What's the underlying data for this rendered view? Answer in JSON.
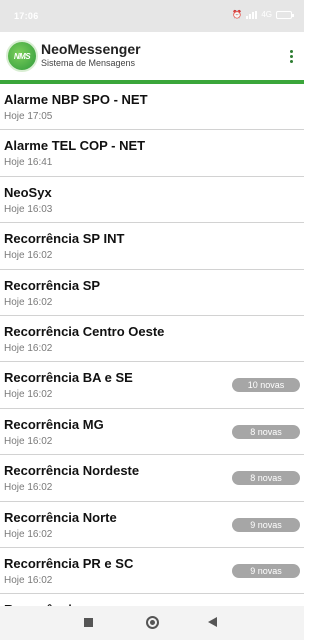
{
  "status_bar": {
    "time": "17:06",
    "network": "4G"
  },
  "app": {
    "title": "NeoMessenger",
    "subtitle": "Sistema de Mensagens",
    "logo_text": "NMS"
  },
  "conversations": [
    {
      "title": "Alarme NBP SPO - NET",
      "time": "Hoje 17:05",
      "badge": ""
    },
    {
      "title": "Alarme TEL COP - NET",
      "time": "Hoje 16:41",
      "badge": ""
    },
    {
      "title": "NeoSyx",
      "time": "Hoje 16:03",
      "badge": ""
    },
    {
      "title": "Recorrência SP INT",
      "time": "Hoje 16:02",
      "badge": ""
    },
    {
      "title": "Recorrência SP",
      "time": "Hoje 16:02",
      "badge": ""
    },
    {
      "title": "Recorrência Centro Oeste",
      "time": "Hoje 16:02",
      "badge": ""
    },
    {
      "title": "Recorrência BA e SE",
      "time": "Hoje 16:02",
      "badge": "10 novas"
    },
    {
      "title": "Recorrência MG",
      "time": "Hoje 16:02",
      "badge": "8 novas"
    },
    {
      "title": "Recorrência Nordeste",
      "time": "Hoje 16:02",
      "badge": "8 novas"
    },
    {
      "title": "Recorrência Norte",
      "time": "Hoje 16:02",
      "badge": "9 novas"
    },
    {
      "title": "Recorrência PR e SC",
      "time": "Hoje 16:02",
      "badge": "9 novas"
    },
    {
      "title": "Recorrência",
      "time": "",
      "badge": ""
    }
  ],
  "colors": {
    "accent": "#3aa63a",
    "badge": "#a6a6a6"
  },
  "icons": {
    "overflow": "more-vert-icon",
    "nav_recents": "square-icon",
    "nav_home": "circle-icon",
    "nav_back": "triangle-back-icon"
  }
}
